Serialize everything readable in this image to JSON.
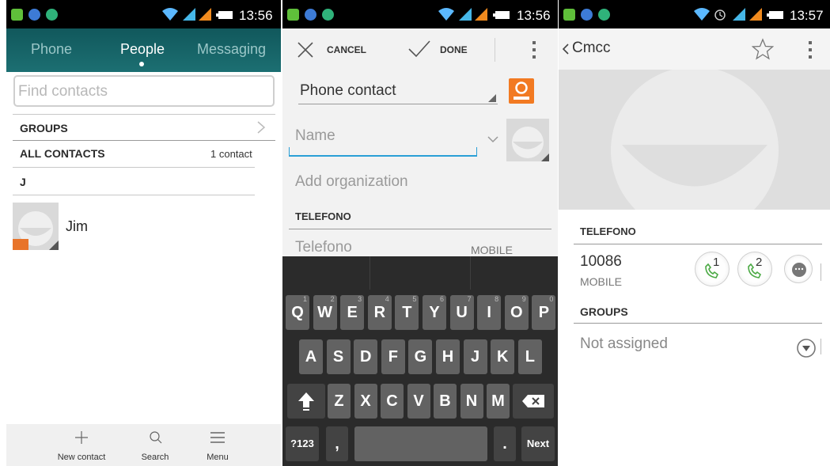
{
  "colors": {
    "teal_header": "#1c6f72",
    "tab_inactive": "#9bc7c8",
    "keyboard_bg": "#2b2b2b",
    "key_bg": "#626262",
    "call_green": "#4caa45",
    "accent_orange": "#f27a22",
    "input_underline": "#2a9fd6"
  },
  "screen1": {
    "status_time": "13:56",
    "tabs": [
      "Phone",
      "People",
      "Messaging"
    ],
    "search_placeholder": "Find contacts",
    "groups_label": "GROUPS",
    "all_contacts_label": "ALL CONTACTS",
    "contact_count": "1 contact",
    "index_letter": "J",
    "contacts": [
      {
        "name": "Jim"
      }
    ],
    "bottom_bar": {
      "new_contact": "New contact",
      "search": "Search",
      "menu": "Menu"
    },
    "icons": [
      "plus-icon",
      "search-icon",
      "menu-icon",
      "chevron-right-icon"
    ]
  },
  "screen2": {
    "status_time": "13:56",
    "cancel_label": "CANCEL",
    "done_label": "DONE",
    "account_type": "Phone contact",
    "name_placeholder": "Name",
    "organization_placeholder": "Add organization",
    "phone_section": "TELEFONO",
    "phone_placeholder": "Telefono",
    "phone_type": "MOBILE",
    "keyboard": {
      "row1": [
        "Q",
        "W",
        "E",
        "R",
        "T",
        "Y",
        "U",
        "I",
        "O",
        "P"
      ],
      "row1_nums": [
        "1",
        "2",
        "3",
        "4",
        "5",
        "6",
        "7",
        "8",
        "9",
        "0"
      ],
      "row2": [
        "A",
        "S",
        "D",
        "F",
        "G",
        "H",
        "J",
        "K",
        "L"
      ],
      "row3": [
        "Z",
        "X",
        "C",
        "V",
        "B",
        "N",
        "M"
      ],
      "symbols_key": "?123",
      "comma_key": ",",
      "period_key": ".",
      "next_key": "Next"
    }
  },
  "screen3": {
    "status_time": "13:57",
    "back_title": "Cmcc",
    "phone_section": "TELEFONO",
    "phone_number": "10086",
    "phone_type": "MOBILE",
    "sim1": "1",
    "sim2": "2",
    "groups_section": "GROUPS",
    "groups_value": "Not assigned"
  }
}
